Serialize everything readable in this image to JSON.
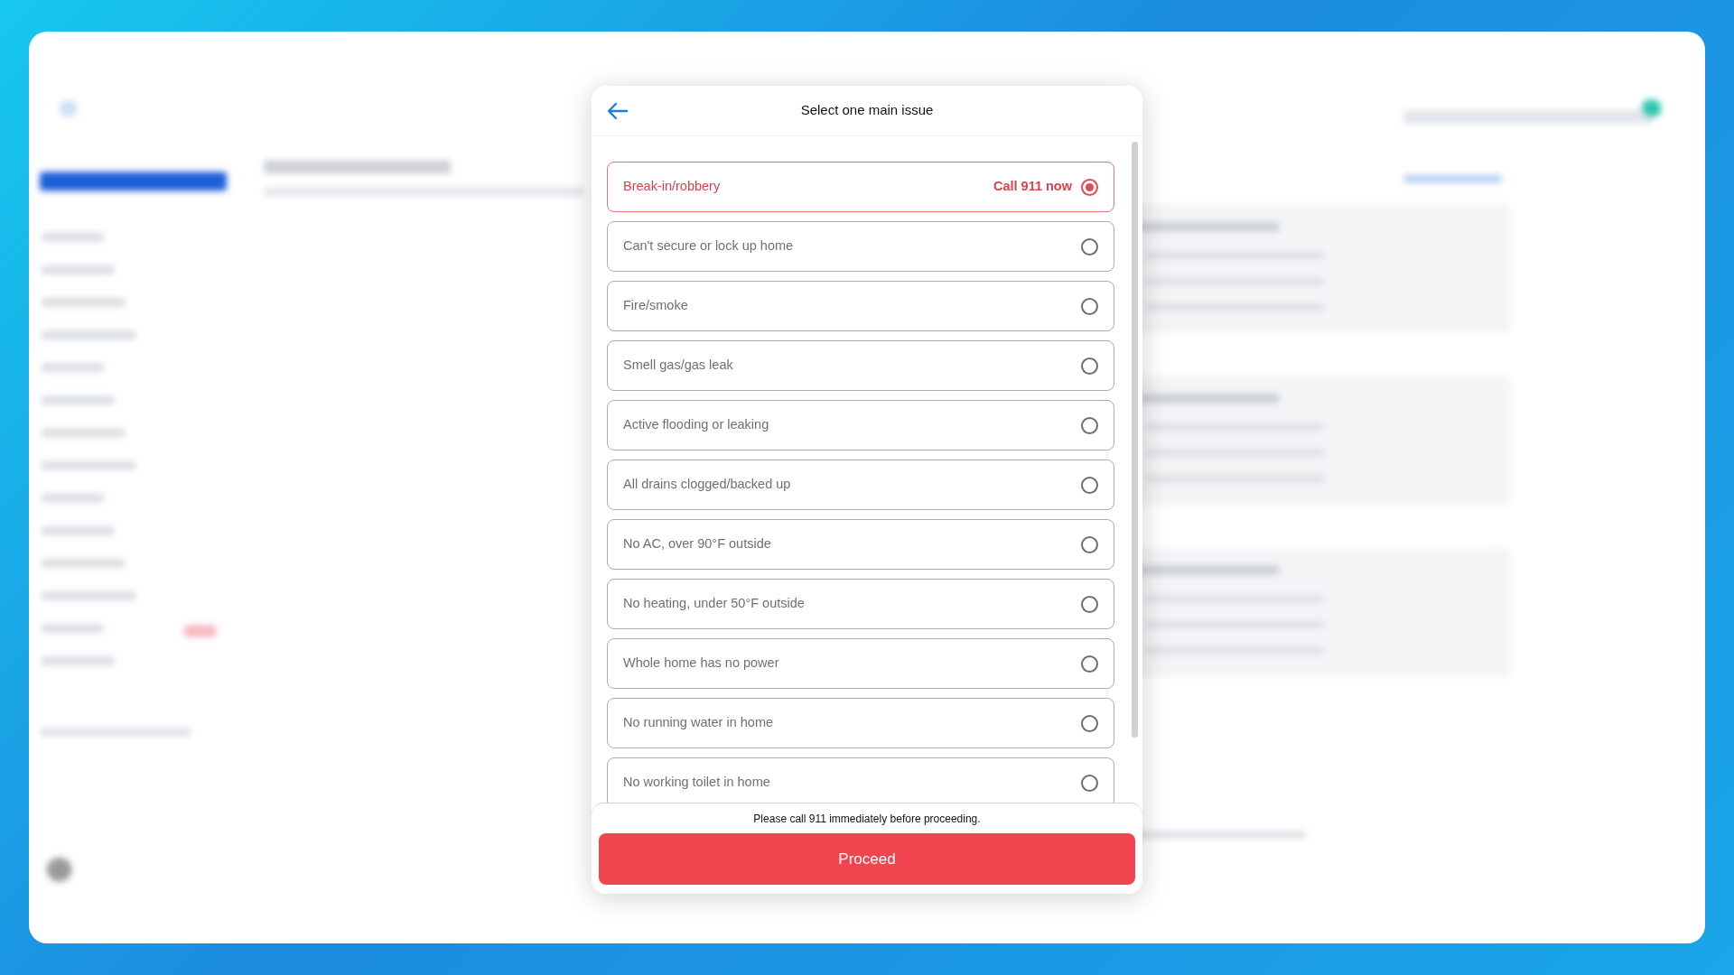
{
  "dialog": {
    "title": "Select one main issue",
    "options": [
      {
        "label": "Break-in/robbery",
        "badge": "Call 911 now",
        "selected": true
      },
      {
        "label": "Can't secure or lock up home",
        "selected": false
      },
      {
        "label": "Fire/smoke",
        "selected": false
      },
      {
        "label": "Smell gas/gas leak",
        "selected": false
      },
      {
        "label": "Active flooding or leaking",
        "selected": false
      },
      {
        "label": "All drains clogged/backed up",
        "selected": false
      },
      {
        "label": "No AC, over 90°F outside",
        "selected": false
      },
      {
        "label": "No heating, under 50°F outside",
        "selected": false
      },
      {
        "label": "Whole home has no power",
        "selected": false
      },
      {
        "label": "No running water in home",
        "selected": false
      },
      {
        "label": "No working toilet in home",
        "selected": false
      }
    ],
    "notice": "Please call 911 immediately before proceeding.",
    "button": "Proceed"
  }
}
